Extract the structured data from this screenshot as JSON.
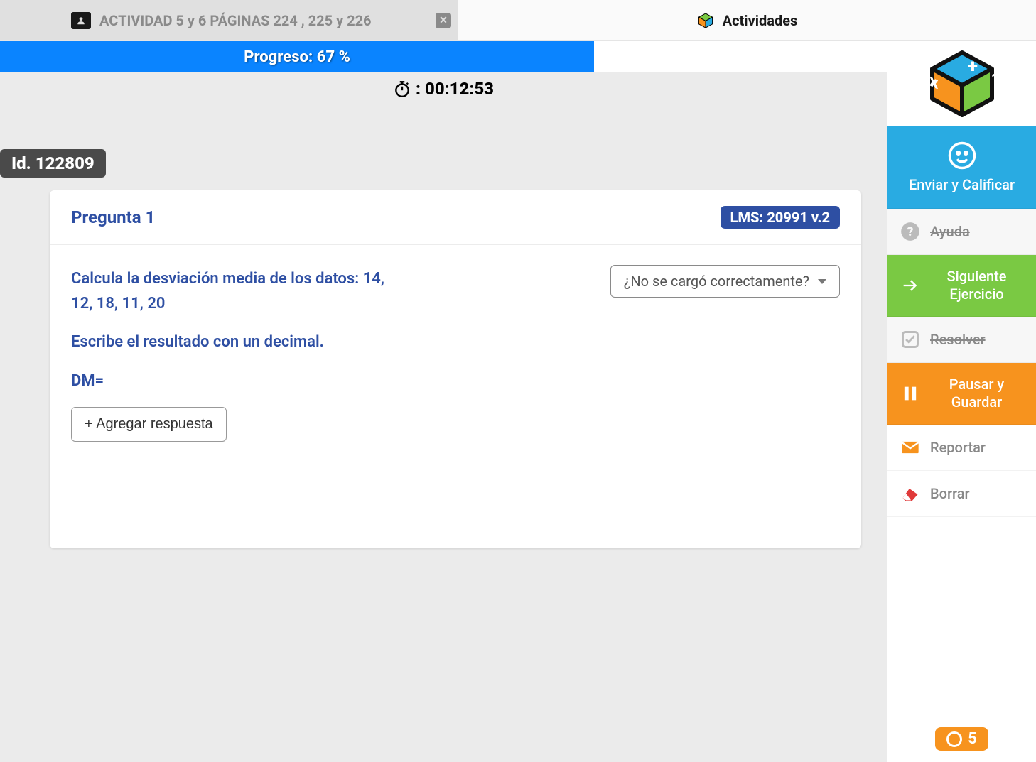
{
  "tabs": {
    "activity_title": "ACTIVIDAD 5 y 6 PÁGINAS 224 , 225 y 226",
    "activities_label": "Actividades"
  },
  "progress": {
    "label": "Progreso: 67 %",
    "percent": 67
  },
  "timer": {
    "value": "00:12:53"
  },
  "exercise_id": {
    "label": "Id. 122809"
  },
  "question": {
    "title": "Pregunta 1",
    "lms_badge": "LMS: 20991 v.2",
    "prompt_main": "Calcula la desviación media de los datos: 14, 12, 18, 11, 20",
    "prompt_sub": "Escribe el resultado con un decimal.",
    "dm_label": "DM=",
    "load_error_prompt": "¿No se cargó correctamente?",
    "add_answer_label": "+ Agregar respuesta"
  },
  "sidebar": {
    "submit": "Enviar y Calificar",
    "help": "Ayuda",
    "next": "Siguiente Ejercicio",
    "solve": "Resolver",
    "pause": "Pausar y Guardar",
    "report": "Reportar",
    "erase": "Borrar",
    "footer_count": "5"
  }
}
